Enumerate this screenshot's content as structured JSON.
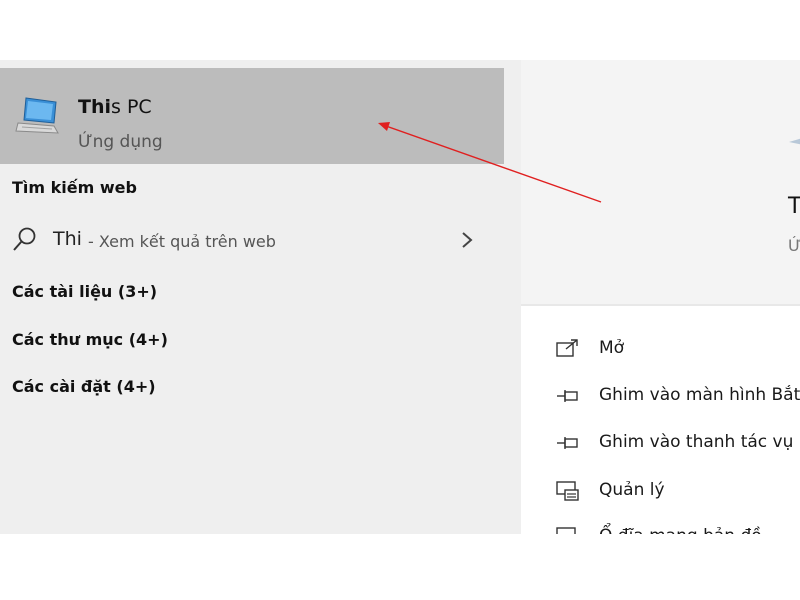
{
  "best_match": {
    "title_bold": "Thi",
    "title_rest": "s PC",
    "subtitle": "Ứng dụng",
    "icon": "this-pc-icon"
  },
  "web_section": {
    "heading": "Tìm kiếm web",
    "query": "Thi",
    "suffix": "- Xem kết quả trên web",
    "icon": "search-icon"
  },
  "categories": [
    {
      "label": "Các tài liệu (3+)"
    },
    {
      "label": "Các thư mục (4+)"
    },
    {
      "label": "Các cài đặt (4+)"
    }
  ],
  "preview": {
    "title": "T",
    "subtitle": "Ứ"
  },
  "actions": [
    {
      "label": "Mở",
      "icon": "open-icon"
    },
    {
      "label": "Ghim vào màn hình Bắt",
      "icon": "pin-icon"
    },
    {
      "label": "Ghim vào thanh tác vụ",
      "icon": "pin-icon"
    },
    {
      "label": "Quản lý",
      "icon": "manage-icon"
    },
    {
      "label": "Ổ đĩa mạng bản đồ",
      "icon": "map-drive-icon"
    }
  ],
  "colors": {
    "selected_bg": "#bcbcbc",
    "panel_bg": "#efefef",
    "arrow": "#e02020"
  }
}
